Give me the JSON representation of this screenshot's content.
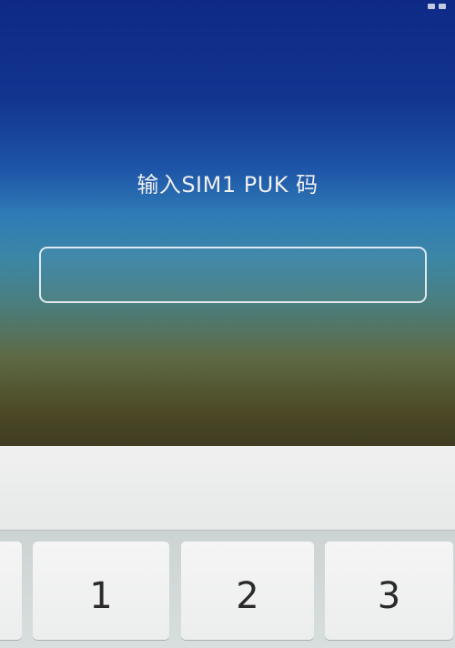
{
  "lock_screen": {
    "prompt": "输入SIM1 PUK 码",
    "puk_input": {
      "value": "",
      "placeholder": ""
    }
  },
  "keypad": {
    "keys": [
      {
        "label": "1"
      },
      {
        "label": "2"
      },
      {
        "label": "3"
      }
    ]
  },
  "colors": {
    "background_top": "#0e2a86",
    "background_mid": "#2f7bb6",
    "background_bottom": "#3f3c22",
    "text": "#eef1f3",
    "key_face": "#f4f5f4",
    "keypad_tray": "#ccd4d3"
  }
}
